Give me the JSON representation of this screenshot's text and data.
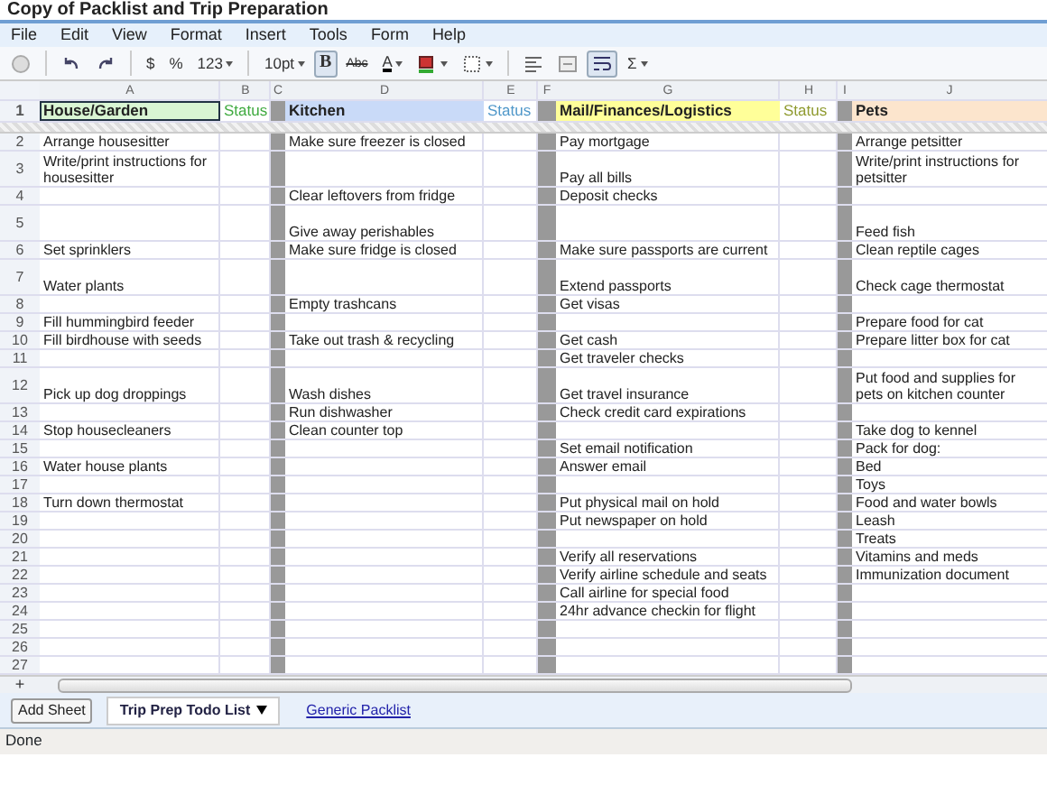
{
  "window": {
    "title": "Copy of Packlist and Trip Preparation"
  },
  "menu": [
    "File",
    "Edit",
    "View",
    "Format",
    "Insert",
    "Tools",
    "Form",
    "Help"
  ],
  "toolbar": [
    {
      "kind": "print",
      "selected": false
    },
    {
      "kind": "separator"
    },
    {
      "kind": "undo",
      "selected": false
    },
    {
      "kind": "redo",
      "selected": false
    },
    {
      "kind": "separator"
    },
    {
      "kind": "text",
      "label": "$",
      "selected": false
    },
    {
      "kind": "text",
      "label": "%",
      "selected": false
    },
    {
      "kind": "dropdown",
      "label": "123",
      "selected": false
    },
    {
      "kind": "separator"
    },
    {
      "kind": "dropdown",
      "label": "10pt",
      "selected": false
    },
    {
      "kind": "bold",
      "label": "B",
      "selected": true
    },
    {
      "kind": "strike",
      "label": "Abc",
      "selected": false
    },
    {
      "kind": "textcolor",
      "label": "A",
      "selected": false
    },
    {
      "kind": "fill",
      "selected": false
    },
    {
      "kind": "borders",
      "selected": false
    },
    {
      "kind": "separator"
    },
    {
      "kind": "align",
      "selected": false
    },
    {
      "kind": "merge",
      "selected": false
    },
    {
      "kind": "wrap",
      "selected": true
    },
    {
      "kind": "dropdown",
      "label": "Σ",
      "selected": false
    }
  ],
  "column_headers": [
    "A",
    "B",
    "C",
    "D",
    "E",
    "F",
    "G",
    "H",
    "I",
    "J"
  ],
  "header_row": {
    "number": "1",
    "cells": [
      {
        "kind": "section",
        "text": "House/Garden",
        "color": "#d9f5d3",
        "selected": true
      },
      {
        "kind": "status",
        "text": "Status",
        "color": "#3faa3f",
        "selected": false
      },
      {
        "kind": "section",
        "text": "Kitchen",
        "color": "#c9daf8",
        "selected": false
      },
      {
        "kind": "status",
        "text": "Status",
        "color": "#4f97c9",
        "selected": false
      },
      {
        "kind": "section",
        "text": "Mail/Finances/Logistics",
        "color": "#ffff99",
        "selected": false
      },
      {
        "kind": "status",
        "text": "Status",
        "color": "#8f9a2f",
        "selected": false
      },
      {
        "kind": "section",
        "text": "Pets",
        "color": "#fce5cd",
        "selected": false
      }
    ]
  },
  "rows": [
    {
      "number": "2",
      "tall": false,
      "house_garden": "Arrange housesitter",
      "kitchen": "Make sure freezer is closed",
      "mail": "Pay mortgage",
      "pets": "Arrange petsitter"
    },
    {
      "number": "3",
      "tall": true,
      "house_garden": "Write/print instructions for housesitter",
      "mail": "Pay all bills",
      "pets": "Write/print instructions for petsitter"
    },
    {
      "number": "4",
      "tall": false,
      "kitchen": "Clear leftovers from fridge",
      "mail": "Deposit checks"
    },
    {
      "number": "5",
      "tall": true,
      "kitchen": "Give away perishables",
      "pets": "Feed fish"
    },
    {
      "number": "6",
      "tall": false,
      "house_garden": "Set sprinklers",
      "kitchen": "Make sure fridge is closed",
      "mail": "Make sure passports are current",
      "pets": "Clean reptile cages"
    },
    {
      "number": "7",
      "tall": true,
      "house_garden": "Water plants",
      "mail": "Extend passports",
      "pets": "Check cage thermostat"
    },
    {
      "number": "8",
      "tall": false,
      "kitchen": "Empty trashcans",
      "mail": "Get visas"
    },
    {
      "number": "9",
      "tall": false,
      "house_garden": "Fill hummingbird feeder",
      "pets": "Prepare food for cat"
    },
    {
      "number": "10",
      "tall": false,
      "house_garden": "Fill birdhouse with seeds",
      "kitchen": "Take out trash & recycling",
      "mail": "Get cash",
      "pets": "Prepare litter box for cat"
    },
    {
      "number": "11",
      "tall": false,
      "mail": "Get traveler checks"
    },
    {
      "number": "12",
      "tall": true,
      "house_garden": "Pick up dog droppings",
      "kitchen": "Wash dishes",
      "mail": "Get travel insurance",
      "pets": "Put food and supplies for pets on kitchen counter"
    },
    {
      "number": "13",
      "tall": false,
      "kitchen": "Run dishwasher",
      "mail": "Check credit card expirations"
    },
    {
      "number": "14",
      "tall": false,
      "house_garden": "Stop housecleaners",
      "kitchen": "Clean counter top",
      "pets": "Take dog to kennel"
    },
    {
      "number": "15",
      "tall": false,
      "mail": "Set email notification",
      "pets": "Pack for dog:"
    },
    {
      "number": "16",
      "tall": false,
      "house_garden": "Water house plants",
      "mail": "Answer email",
      "pets": "Bed"
    },
    {
      "number": "17",
      "tall": false,
      "pets": "Toys"
    },
    {
      "number": "18",
      "tall": false,
      "house_garden": "Turn down thermostat",
      "mail": "Put physical mail on hold",
      "pets": "Food and water bowls"
    },
    {
      "number": "19",
      "tall": false,
      "mail": "Put newspaper on hold",
      "pets": "Leash"
    },
    {
      "number": "20",
      "tall": false,
      "pets": "Treats"
    },
    {
      "number": "21",
      "tall": false,
      "mail": "Verify all reservations",
      "pets": "Vitamins and meds"
    },
    {
      "number": "22",
      "tall": false,
      "mail": "Verify airline schedule and seats",
      "pets": "Immunization document"
    },
    {
      "number": "23",
      "tall": false,
      "mail": "Call airline for special food"
    },
    {
      "number": "24",
      "tall": false,
      "mail": "24hr advance checkin for flight"
    },
    {
      "number": "25",
      "tall": false
    },
    {
      "number": "26",
      "tall": false
    },
    {
      "number": "27",
      "tall": false
    }
  ],
  "add_row": "+",
  "add_sheet_button": "Add Sheet",
  "sheet_tabs": [
    {
      "label": "Trip Prep Todo List",
      "selected": true
    },
    {
      "label": "Generic Packlist",
      "selected": false
    }
  ],
  "status_bar": "Done"
}
